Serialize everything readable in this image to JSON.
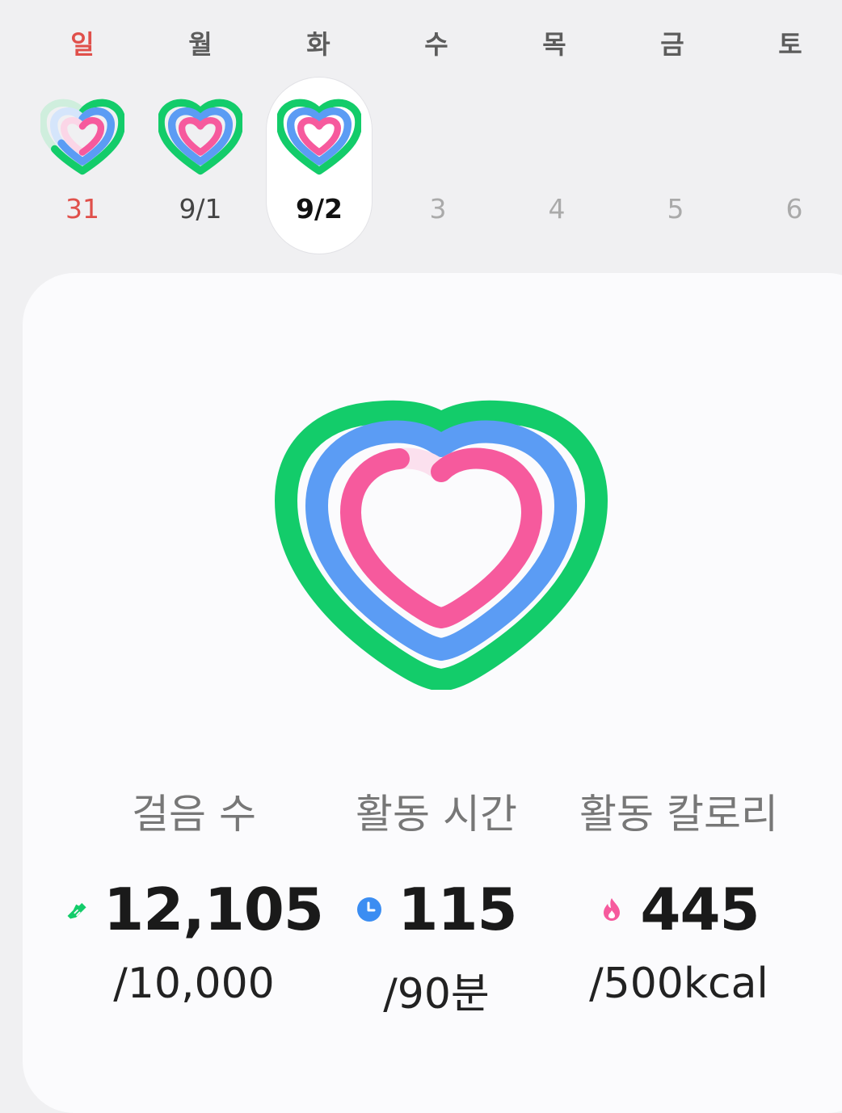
{
  "week": {
    "days": [
      {
        "label": "일",
        "date": "31"
      },
      {
        "label": "월",
        "date": "9/1"
      },
      {
        "label": "화",
        "date": "9/2"
      },
      {
        "label": "수",
        "date": "3"
      },
      {
        "label": "목",
        "date": "4"
      },
      {
        "label": "금",
        "date": "5"
      },
      {
        "label": "토",
        "date": "6"
      }
    ],
    "selected_index": 2
  },
  "summary": {
    "stats": [
      {
        "label": "걸음 수",
        "value": "12,105",
        "goal": "/10,000",
        "icon": "shoe-icon"
      },
      {
        "label": "활동 시간",
        "value": "115",
        "goal": "/90분",
        "icon": "clock-icon"
      },
      {
        "label": "활동 칼로리",
        "value": "445",
        "goal": "/500kcal",
        "icon": "flame-icon"
      }
    ]
  },
  "colors": {
    "steps_ring": "#13cc6a",
    "time_ring": "#5b9cf4",
    "calorie_ring": "#f65a9d",
    "sunday": "#e0504b"
  }
}
